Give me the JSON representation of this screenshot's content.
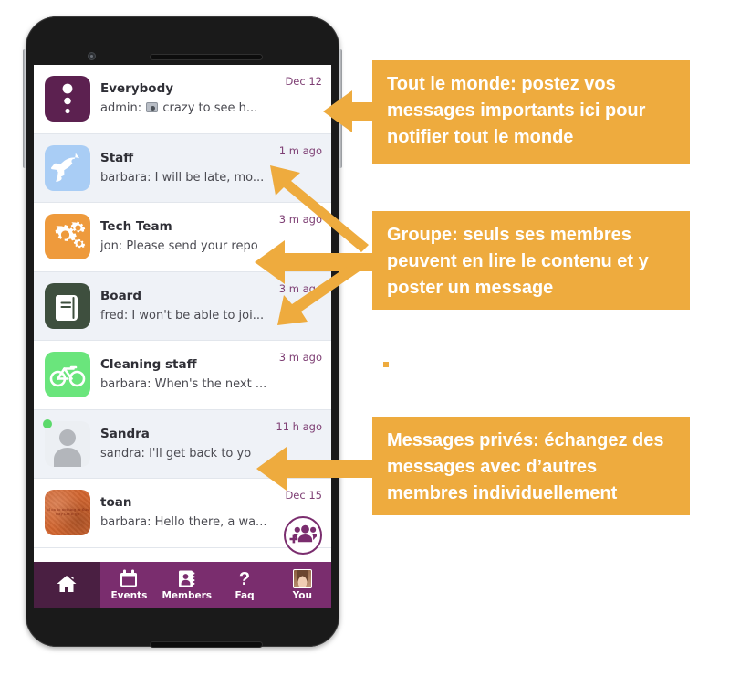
{
  "app": {
    "screen_name": "Conversations list"
  },
  "conversations": [
    {
      "name": "Everybody",
      "snippet_prefix": "admin:",
      "snippet_has_photo_emoji": true,
      "snippet": "crazy to see h...",
      "time": "Dec 12",
      "avatar_icon": "broadcast-dots-icon",
      "avatar_color": "#5c2150",
      "row_shade": "white",
      "online": false
    },
    {
      "name": "Staff",
      "snippet_prefix": "barbara:",
      "snippet_has_photo_emoji": false,
      "snippet": "I will be late, mo...",
      "time": "1 m ago",
      "avatar_icon": "rocket-icon",
      "avatar_color": "#a9cdf5",
      "row_shade": "alt",
      "online": false
    },
    {
      "name": "Tech Team",
      "snippet_prefix": "jon:",
      "snippet_has_photo_emoji": false,
      "snippet": "Please send your repo",
      "time": "3 m ago",
      "avatar_icon": "gears-icon",
      "avatar_color": "#ee9a3c",
      "row_shade": "white",
      "online": false
    },
    {
      "name": "Board",
      "snippet_prefix": "fred:",
      "snippet_has_photo_emoji": false,
      "snippet": "I won't be able to joi...",
      "time": "3 m ago",
      "avatar_icon": "book-icon",
      "avatar_color": "#3e4f3e",
      "row_shade": "alt",
      "online": false
    },
    {
      "name": "Cleaning staff",
      "snippet_prefix": "barbara:",
      "snippet_has_photo_emoji": false,
      "snippet": "When's the next ...",
      "time": "3 m ago",
      "avatar_icon": "bicycle-icon",
      "avatar_color": "#6ae57c",
      "row_shade": "white",
      "online": false
    },
    {
      "name": "Sandra",
      "snippet_prefix": "sandra:",
      "snippet_has_photo_emoji": false,
      "snippet": "I'll get back to yo",
      "time": "11 h ago",
      "avatar_icon": "person-placeholder-icon",
      "avatar_color": "#eceff3",
      "row_shade": "alt",
      "online": true
    },
    {
      "name": "toan",
      "snippet_prefix": "barbara:",
      "snippet_has_photo_emoji": false,
      "snippet": "Hello there, a wa...",
      "time": "Dec 15",
      "avatar_icon": "photo-avatar",
      "avatar_color": "#d2652f",
      "avatar_photo_caption": "Id on to nothing in this way Let it go",
      "row_shade": "white",
      "online": false
    }
  ],
  "fab": {
    "label": "new-group",
    "icon": "add-group-icon",
    "color": "#7a2d6e"
  },
  "bottom_nav": {
    "background": "#7a2d6e",
    "active_background": "#4a1f42",
    "items": [
      {
        "label": "",
        "icon": "home-icon",
        "active": true
      },
      {
        "label": "Events",
        "icon": "calendar-icon",
        "active": false
      },
      {
        "label": "Members",
        "icon": "contact-card-icon",
        "active": false
      },
      {
        "label": "Faq",
        "icon": "question-mark-icon",
        "active": false
      },
      {
        "label": "You",
        "icon": "profile-photo-icon",
        "active": false
      }
    ]
  },
  "callouts": {
    "accent_color": "#eeab3e",
    "everybody": "Tout le monde: postez vos messages importants ici pour notifier tout le monde",
    "group": "Groupe: seuls ses membres peuvent en lire le contenu et y poster un message",
    "private": "Messages privés: échangez des messages avec d’autres membres individuellement"
  }
}
